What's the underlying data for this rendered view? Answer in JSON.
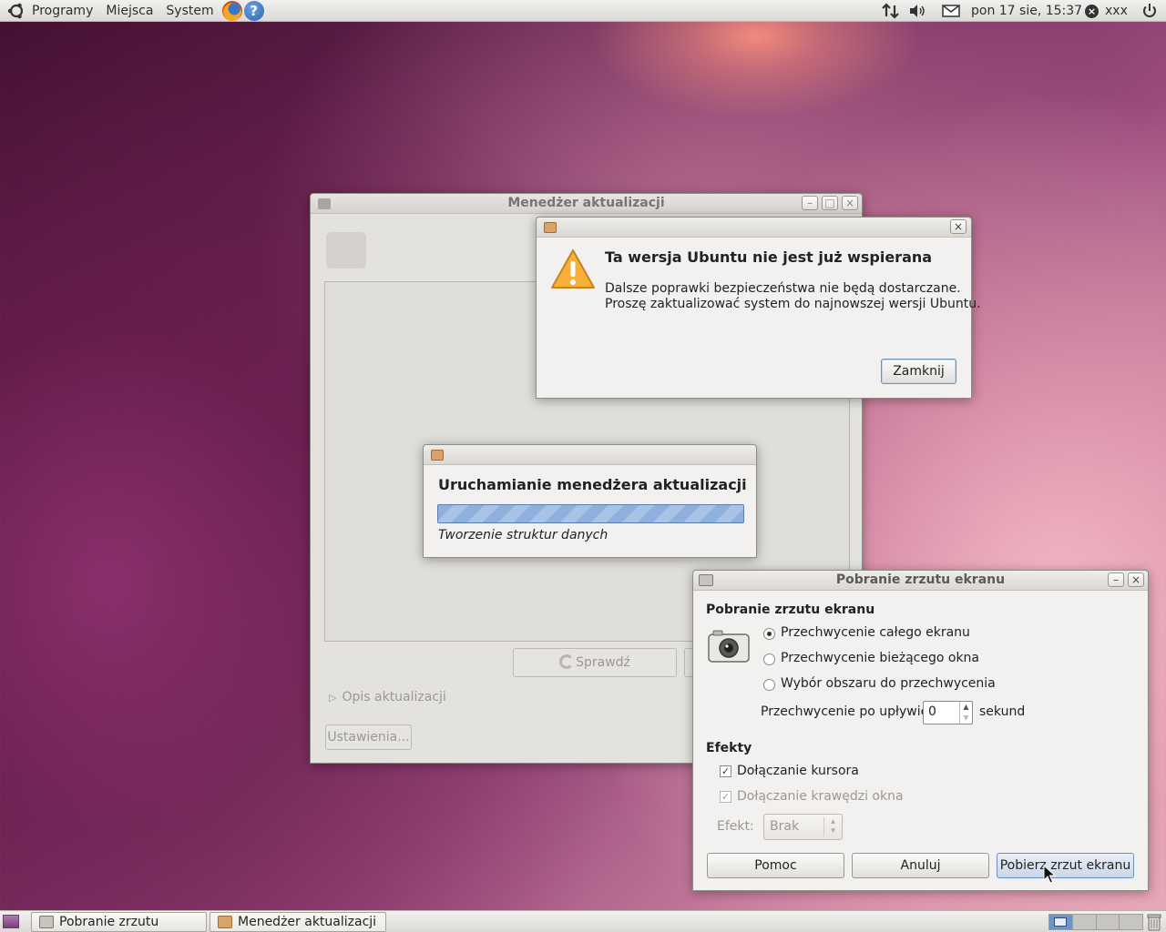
{
  "top_panel": {
    "menus": [
      "Programy",
      "Miejsca",
      "System"
    ],
    "clock": "pon 17 sie, 15:37",
    "user": "xxx"
  },
  "update_manager": {
    "title": "Menedżer aktualizacji",
    "check_button": "Sprawdź",
    "description_expander": "Opis aktualizacji",
    "settings_button": "Ustawienia..."
  },
  "unsupported_dialog": {
    "heading": "Ta wersja Ubuntu nie jest już wspierana",
    "message_line1": "Dalsze poprawki bezpieczeństwa nie będą dostarczane.",
    "message_line2": "Proszę zaktualizować system do najnowszej wersji Ubuntu.",
    "close_button": "Zamknij"
  },
  "startup_dialog": {
    "heading": "Uruchamianie menedżera aktualizacji",
    "status": "Tworzenie struktur danych"
  },
  "screenshot_dialog": {
    "title": "Pobranie zrzutu ekranu",
    "section_title": "Pobranie zrzutu ekranu",
    "options": [
      {
        "label": "Przechwycenie całego ekranu",
        "selected": true
      },
      {
        "label": "Przechwycenie bieżącego okna",
        "selected": false
      },
      {
        "label": "Wybór obszaru do przechwycenia",
        "selected": false
      }
    ],
    "delay_label": "Przechwycenie po upływie",
    "delay_value": "0",
    "delay_unit": "sekund",
    "effects_title": "Efekty",
    "include_pointer": "Dołączanie kursora",
    "include_border": "Dołączanie krawędzi okna",
    "effect_label": "Efekt:",
    "effect_value": "Brak",
    "help_button": "Pomoc",
    "cancel_button": "Anuluj",
    "take_button": "Pobierz zrzut ekranu"
  },
  "taskbar": {
    "items": [
      "Pobranie zrzutu ekranu",
      "Menedżer aktualizacji"
    ]
  }
}
